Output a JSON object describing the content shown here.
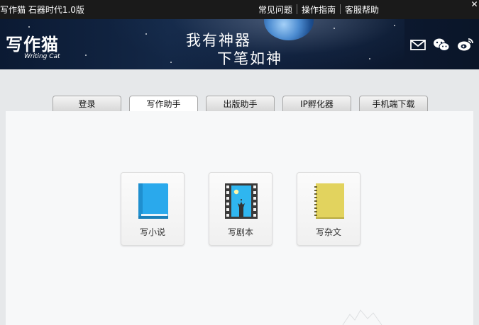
{
  "titlebar": {
    "app_title": "写作猫  石器时代1.0版",
    "menu": [
      "常见问题",
      "操作指南",
      "客服帮助"
    ],
    "close_glyph": "✕"
  },
  "banner": {
    "logo_cn": "写作猫",
    "logo_en": "Writing Cat",
    "slogan_line1": "我有神器",
    "slogan_line2": "下笔如神",
    "icons": [
      "mail-icon",
      "wechat-icon",
      "weibo-icon"
    ]
  },
  "tabs": [
    {
      "label": "登录",
      "active": false
    },
    {
      "label": "写作助手",
      "active": true
    },
    {
      "label": "出版助手",
      "active": false
    },
    {
      "label": "IP孵化器",
      "active": false
    },
    {
      "label": "手机端下载",
      "active": false
    }
  ],
  "cards": [
    {
      "label": "写小说",
      "icon": "book-icon"
    },
    {
      "label": "写剧本",
      "icon": "film-icon"
    },
    {
      "label": "写杂文",
      "icon": "notebook-icon"
    }
  ],
  "colors": {
    "titlebar_bg": "#1a1a1a",
    "book_blue": "#2aa9ec",
    "film_dark": "#3a3a3a",
    "film_sky": "#2fb6f0",
    "notebook_yellow": "#e2d35e"
  }
}
